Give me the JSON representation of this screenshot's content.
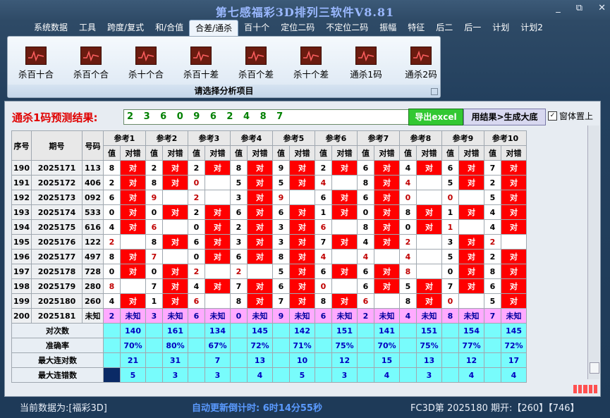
{
  "app": {
    "title": "第七感福彩3D排列三软件V8.81"
  },
  "window_controls": {
    "minimize": "_",
    "restore": "⧉",
    "close": "✕"
  },
  "menu": [
    "系统数据",
    "工具",
    "跨度/复式",
    "和/合值",
    "合差/通杀",
    "百十个",
    "定位二码",
    "不定位二码",
    "振幅",
    "特征",
    "后二",
    "后一",
    "计划",
    "计划2"
  ],
  "menu_active_index": 4,
  "ribbon": {
    "tools": [
      "杀百十合",
      "杀百个合",
      "杀十个合",
      "杀百十差",
      "杀百个差",
      "杀十个差",
      "通杀1码",
      "通杀2码"
    ],
    "caption": "请选择分析项目"
  },
  "prediction": {
    "label": "通杀1码预测结果:",
    "value": "2 3 6 0 9 6 2 4 8 7",
    "export_label": "导出excel",
    "generate_label": "用结果>生成大底",
    "topmost_label": "窗体置上",
    "topmost_checked": true
  },
  "table": {
    "head_left": [
      "序号",
      "期号",
      "号码"
    ],
    "refs": [
      "参考1",
      "参考2",
      "参考3",
      "参考4",
      "参考5",
      "参考6",
      "参考7",
      "参考8",
      "参考9",
      "参考10"
    ],
    "sub_head": [
      "值",
      "对错"
    ],
    "rows": [
      {
        "seq": "190",
        "period": "2025171",
        "num": "113",
        "vals": [
          "8",
          "2",
          "2",
          "8",
          "9",
          "2",
          "6",
          "4",
          "6",
          "7"
        ],
        "hit": [
          1,
          1,
          1,
          1,
          1,
          1,
          1,
          1,
          1,
          1
        ],
        "redval": [
          0,
          0,
          0,
          0,
          0,
          0,
          0,
          0,
          0,
          0
        ]
      },
      {
        "seq": "191",
        "period": "2025172",
        "num": "406",
        "vals": [
          "2",
          "8",
          "0",
          "5",
          "5",
          "4",
          "8",
          "4",
          "5",
          "2"
        ],
        "hit": [
          1,
          1,
          0,
          1,
          1,
          0,
          1,
          0,
          1,
          1
        ],
        "redval": [
          0,
          0,
          1,
          0,
          0,
          1,
          0,
          1,
          0,
          0
        ]
      },
      {
        "seq": "192",
        "period": "2025173",
        "num": "092",
        "vals": [
          "6",
          "9",
          "2",
          "3",
          "9",
          "6",
          "6",
          "0",
          "0",
          "5"
        ],
        "hit": [
          1,
          0,
          0,
          1,
          0,
          1,
          1,
          0,
          0,
          1
        ],
        "redval": [
          0,
          1,
          1,
          0,
          1,
          0,
          0,
          1,
          1,
          0
        ]
      },
      {
        "seq": "193",
        "period": "2025174",
        "num": "533",
        "vals": [
          "0",
          "0",
          "2",
          "6",
          "6",
          "1",
          "0",
          "8",
          "1",
          "4"
        ],
        "hit": [
          1,
          1,
          1,
          1,
          1,
          1,
          1,
          1,
          1,
          1
        ],
        "redval": [
          0,
          0,
          0,
          0,
          0,
          0,
          0,
          0,
          0,
          0
        ]
      },
      {
        "seq": "194",
        "period": "2025175",
        "num": "616",
        "vals": [
          "4",
          "6",
          "0",
          "2",
          "3",
          "6",
          "8",
          "0",
          "1",
          "4"
        ],
        "hit": [
          1,
          0,
          1,
          1,
          1,
          0,
          1,
          1,
          0,
          1
        ],
        "redval": [
          0,
          1,
          0,
          0,
          0,
          1,
          0,
          0,
          1,
          0
        ]
      },
      {
        "seq": "195",
        "period": "2025176",
        "num": "122",
        "vals": [
          "2",
          "8",
          "6",
          "3",
          "3",
          "7",
          "4",
          "2",
          "3",
          "2"
        ],
        "hit": [
          0,
          1,
          1,
          1,
          1,
          1,
          1,
          0,
          1,
          0
        ],
        "redval": [
          1,
          0,
          0,
          0,
          0,
          0,
          0,
          1,
          0,
          1
        ]
      },
      {
        "seq": "196",
        "period": "2025177",
        "num": "497",
        "vals": [
          "8",
          "7",
          "0",
          "6",
          "8",
          "4",
          "4",
          "4",
          "5",
          "2"
        ],
        "hit": [
          1,
          0,
          1,
          1,
          1,
          0,
          0,
          0,
          1,
          1
        ],
        "redval": [
          0,
          1,
          0,
          0,
          0,
          1,
          1,
          1,
          0,
          0
        ]
      },
      {
        "seq": "197",
        "period": "2025178",
        "num": "728",
        "cells": "",
        "vals": [
          "0",
          "0",
          "2",
          "2",
          "5",
          "6",
          "6",
          "8",
          "0",
          "8"
        ],
        "hit": [
          1,
          1,
          0,
          0,
          1,
          1,
          1,
          0,
          1,
          1
        ],
        "redval": [
          0,
          0,
          1,
          1,
          0,
          0,
          0,
          1,
          0,
          0
        ]
      },
      {
        "seq": "198",
        "period": "2025179",
        "num": "280",
        "vals": [
          "8",
          "7",
          "4",
          "7",
          "6",
          "0",
          "6",
          "5",
          "7",
          "6"
        ],
        "hit": [
          0,
          1,
          1,
          1,
          1,
          0,
          1,
          1,
          1,
          1
        ],
        "redval": [
          1,
          0,
          0,
          0,
          0,
          1,
          0,
          0,
          0,
          0
        ]
      },
      {
        "seq": "199",
        "period": "2025180",
        "num": "260",
        "vals": [
          "4",
          "1",
          "6",
          "8",
          "7",
          "8",
          "6",
          "8",
          "0",
          "5"
        ],
        "hit": [
          1,
          1,
          0,
          1,
          1,
          1,
          0,
          1,
          0,
          1
        ],
        "redval": [
          0,
          0,
          1,
          0,
          0,
          0,
          1,
          0,
          1,
          0
        ]
      },
      {
        "seq": "200",
        "period": "2025181",
        "num": "未知",
        "vals": [
          "2",
          "3",
          "6",
          "0",
          "9",
          "6",
          "2",
          "4",
          "8",
          "7"
        ],
        "unknown": "未知"
      }
    ],
    "stats": [
      {
        "label": "对次数",
        "values": [
          "140",
          "161",
          "134",
          "145",
          "142",
          "151",
          "141",
          "151",
          "154",
          "145"
        ]
      },
      {
        "label": "准确率",
        "values": [
          "70%",
          "80%",
          "67%",
          "72%",
          "71%",
          "75%",
          "70%",
          "75%",
          "77%",
          "72%"
        ]
      },
      {
        "label": "最大连对数",
        "values": [
          "21",
          "31",
          "7",
          "13",
          "10",
          "12",
          "15",
          "13",
          "12",
          "17"
        ]
      },
      {
        "label": "最大连错数",
        "values": [
          "5",
          "3",
          "3",
          "4",
          "5",
          "3",
          "4",
          "3",
          "4",
          "4"
        ]
      }
    ],
    "hit_label": "对"
  },
  "status": {
    "current_data": "当前数据为:[福彩3D]",
    "countdown": "自动更新倒计时: 6时14分55秒",
    "last_draw": "FC3D第 2025180 期开:【260】【746】"
  },
  "colors": {
    "hit": "#ff0000",
    "next_row": "#ffaaff",
    "stats": "#78fcfc",
    "accent_title": "#9ab8ff"
  }
}
